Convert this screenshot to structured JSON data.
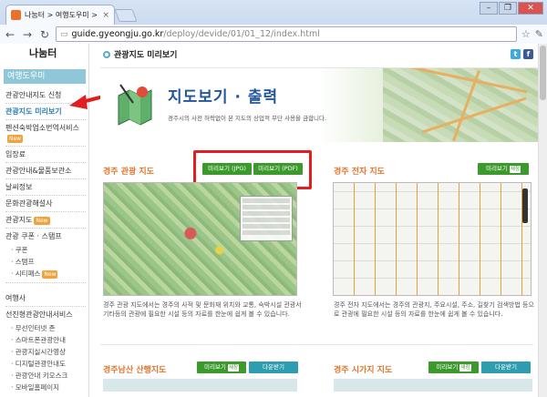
{
  "browser": {
    "tab_title": "나눔터 > 여행도우미 > 관",
    "tab_close": "×",
    "url_host": "guide.gyeongju.go.kr",
    "url_path": "/deploy/devide/01/01_12/index.html",
    "window_controls": [
      "–",
      "❐",
      "✕"
    ]
  },
  "sidebar": {
    "logo": "나눔터",
    "heading": "여행도우미",
    "items": [
      {
        "label": "관광안내지도 신청",
        "badge": ""
      },
      {
        "label": "관광지도 미리보기",
        "badge": ""
      },
      {
        "label": "펜션숙박업소번역서비스",
        "badge": "New"
      },
      {
        "label": "입장료",
        "badge": ""
      },
      {
        "label": "관광안내&물품보관소",
        "badge": ""
      },
      {
        "label": "날씨정보",
        "badge": ""
      },
      {
        "label": "문화관광해설사",
        "badge": ""
      },
      {
        "label": "관광지도",
        "badge": "New"
      },
      {
        "label": "관광 쿠폰 · 스탬프",
        "badge": ""
      }
    ],
    "subitems": [
      {
        "label": "쿠폰",
        "badge": ""
      },
      {
        "label": "스탬프",
        "badge": ""
      },
      {
        "label": "시티패스",
        "badge": "New"
      }
    ],
    "items2": [
      {
        "label": "여행사",
        "badge": ""
      },
      {
        "label": "선진형관광안내서비스",
        "badge": ""
      }
    ],
    "subitems2": [
      "무선인터넷 존",
      "스마트폰관광안내",
      "관광지실시간영상",
      "디지털관광안내도",
      "관광안내 키오스크",
      "모바일홈페이지"
    ]
  },
  "header": {
    "breadcrumb": "관광지도 미리보기",
    "twitter": "t",
    "facebook": "f"
  },
  "banner": {
    "title": "지도보기 · 출력",
    "subtitle": "경주시의 사전 허락없이 본 지도의 상업적 무단 사용을 금합니다."
  },
  "sections": {
    "tour_map": {
      "title": "경주 관광 지도",
      "btn_jpg": "미리보기 (JPG)",
      "btn_pdf": "미리보기 (PDF)",
      "desc": "경주 관광 지도에서는 경주의 사적 및 문화재 위치와 교통, 숙박시설 관광서 기타등의 관광에 필요한 시설 등의 자료를 한눈에 쉽게 볼 수 있습니다."
    },
    "elec_map": {
      "title": "경주 전자 지도",
      "btn_preview": "미리보기",
      "new": "새창",
      "desc": "경주 전자 지도에서는 경주의 관광지, 주요시설, 주소, 길찾기 검색방법 등으로 관광에 필요한 시설 등의 자료를 한눈에 쉽게 볼 수 있습니다."
    },
    "namsan_map": {
      "title": "경주남산 산행지도",
      "btn_preview": "미리보기",
      "new": "새창",
      "btn_download": "다운받기"
    },
    "city_map": {
      "title": "경주 시가지 지도",
      "btn_preview": "미리보기",
      "new": "새창",
      "btn_download": "다운받기"
    }
  },
  "colors": {
    "accent_orange": "#e3752d",
    "button_green": "#3c9a2c",
    "button_teal": "#2e9db0",
    "highlight_red": "#e02020"
  }
}
